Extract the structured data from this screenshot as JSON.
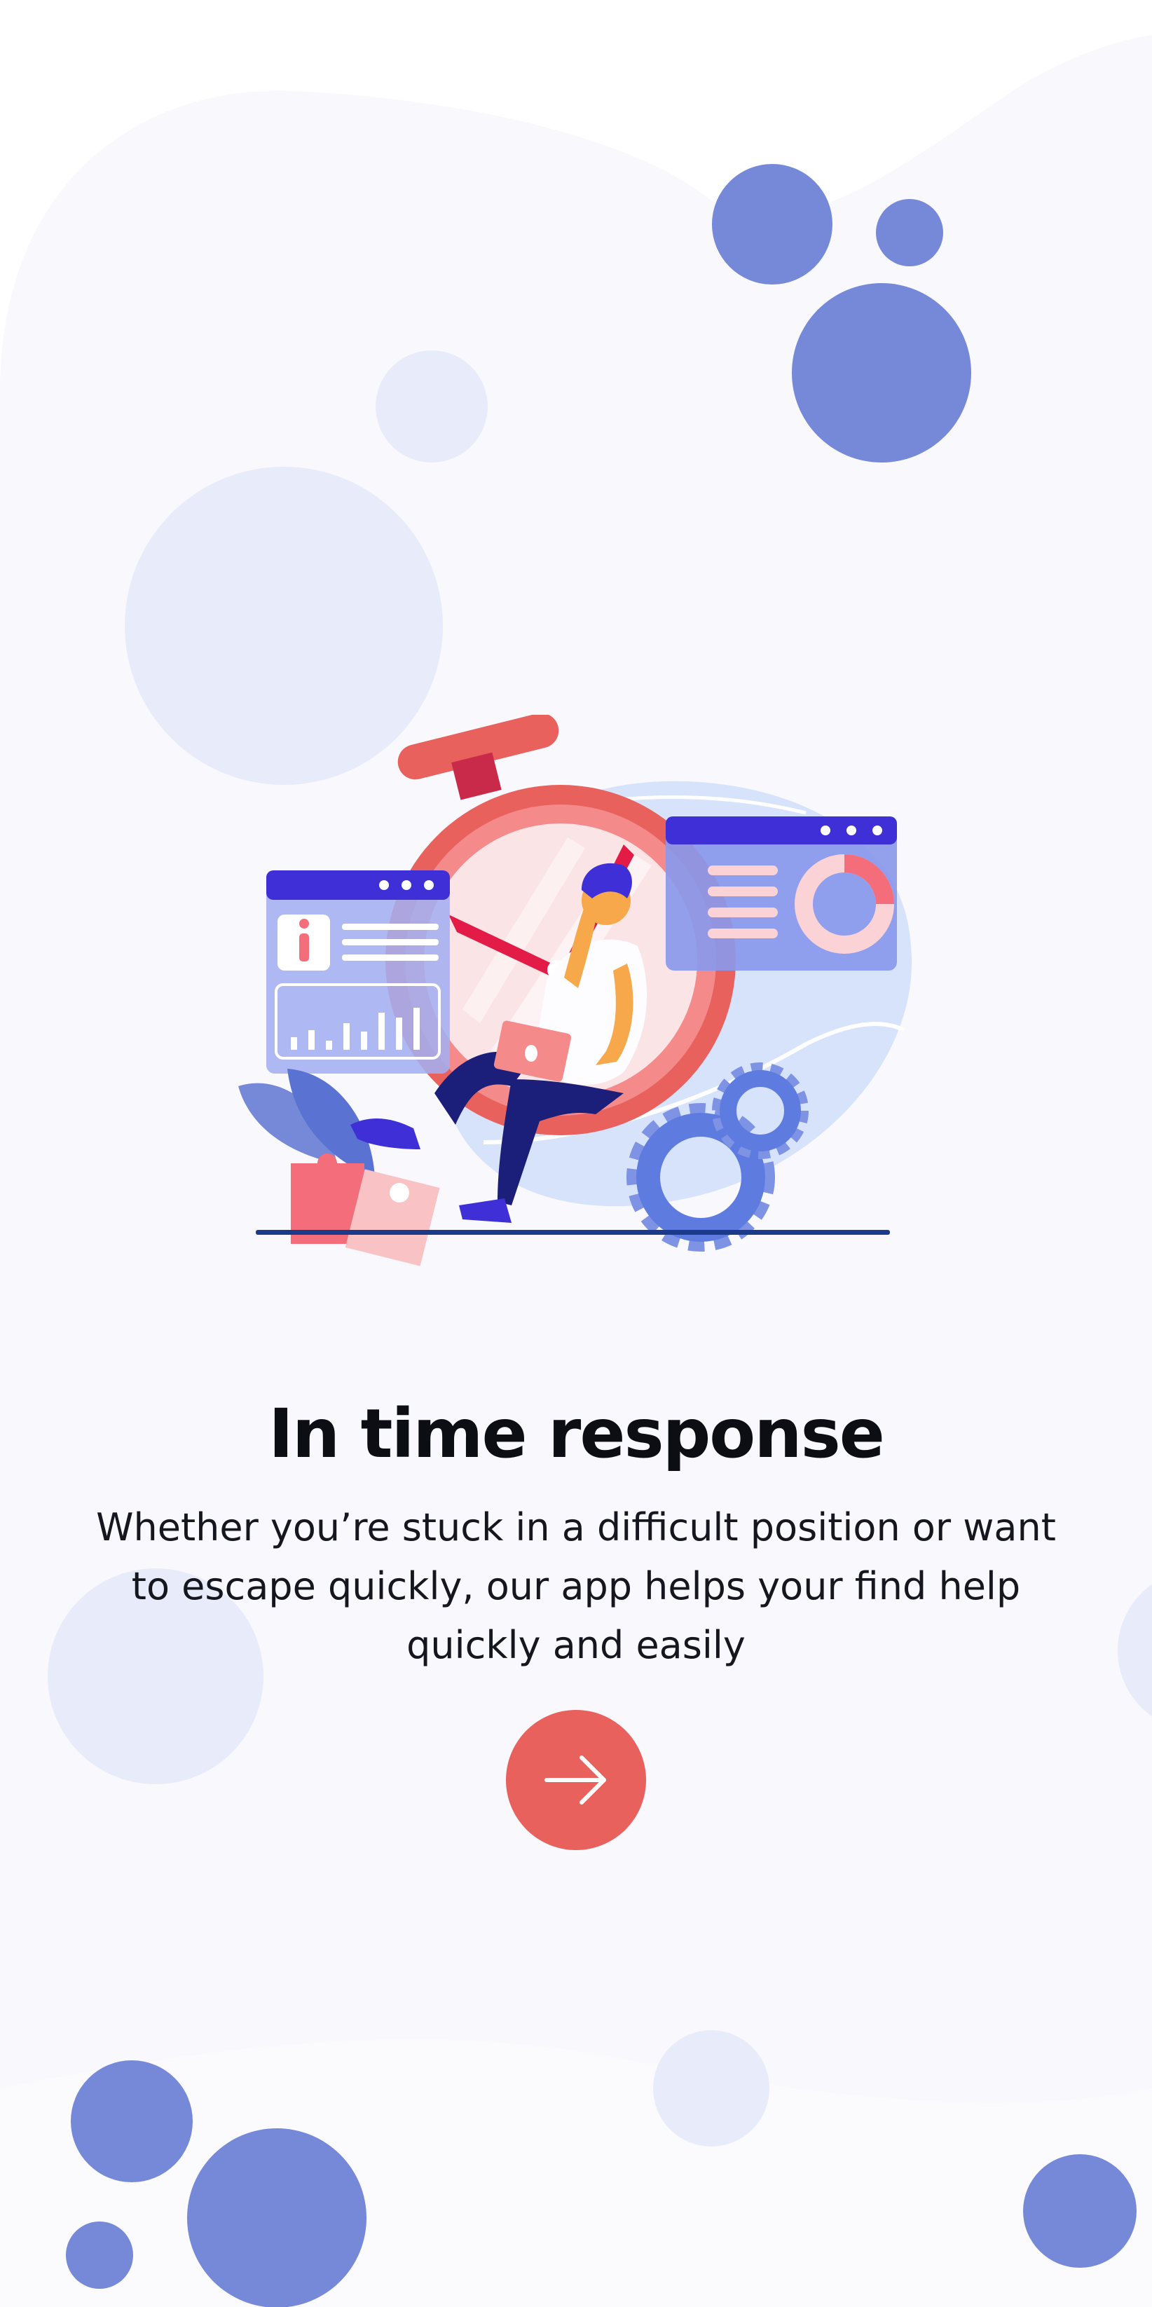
{
  "onboarding": {
    "title": "In time response",
    "description": "Whether you’re stuck in a difficult position or want to escape quickly, our app helps your find help quickly and easily",
    "next_button_icon": "arrow-right-icon",
    "illustration_subject": "stopwatch-time-illustration"
  },
  "colors": {
    "accent": "#e8615d",
    "bubble_dark": "#7589d8",
    "bubble_light": "#e8ecfa",
    "background_blob": "#f8f8fd",
    "title_text": "#0d0d14"
  }
}
